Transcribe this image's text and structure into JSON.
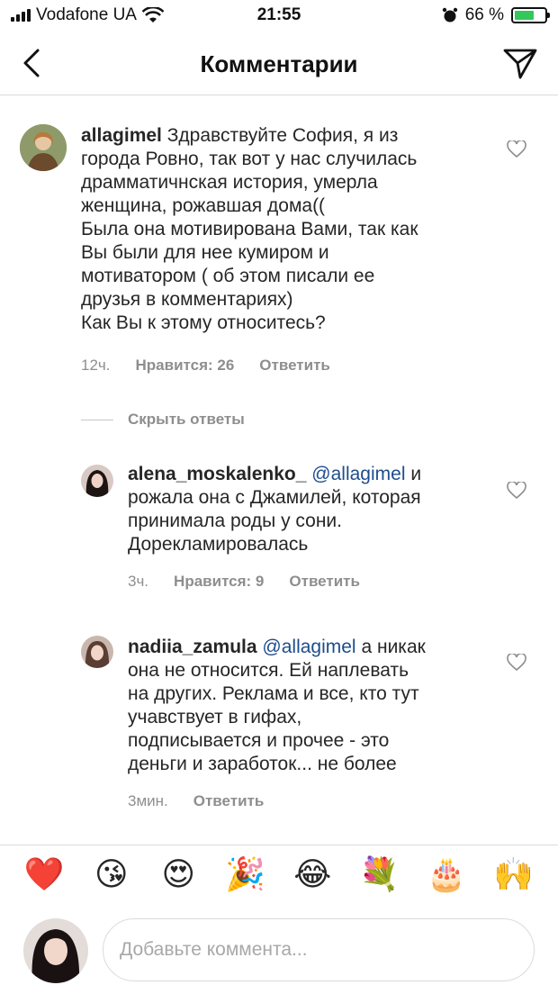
{
  "status_bar": {
    "carrier": "Vodafone UA",
    "time": "21:55",
    "battery": "66 %",
    "battery_level": 0.66
  },
  "header": {
    "title": "Комментарии",
    "back_icon": "chevron-left-icon",
    "send_icon": "paper-plane-icon"
  },
  "comments": [
    {
      "username": "allagimel",
      "mention": "",
      "lines": [
        "allagimel Здравствуйте София, я из",
        "города Ровно, так вот у нас случилась",
        "драмматичнская история, умерла",
        "женщина, рожавшая дома((",
        "Была она мотивирована Вами, так как",
        "Вы были для нее кумиром и",
        "мотиватором ( об этом писали ее",
        "друзья в комментариях)",
        "Как Вы к этому относитесь?"
      ],
      "first_line_rest": "Здравствуйте София, я из",
      "time": "12ч.",
      "likes": "Нравится: 26",
      "reply": "Ответить"
    },
    {
      "username": "alena_moskalenko_",
      "mention": "@allagimel",
      "first_line_rest": "и",
      "lines": [
        "рожала она с Джамилей, которая",
        "принимала роды у сони.",
        "Дорекламировалась"
      ],
      "time": "3ч.",
      "likes": "Нравится: 9",
      "reply": "Ответить"
    },
    {
      "username": "nadiia_zamula",
      "mention": "@allagimel",
      "first_line_rest": "а никак",
      "lines": [
        "она не относится. Ей наплевать",
        "на других. Реклама и все, кто тут",
        "учавствует в гифах,",
        "подписывается и прочее - это",
        "деньги и заработок... не более"
      ],
      "time": "3мин.",
      "reply": "Ответить"
    }
  ],
  "hide_replies": "Скрыть ответы",
  "emoji_bar": [
    "❤️",
    "😘",
    "😍",
    "🎉",
    "😂",
    "💐",
    "🎂",
    "🙌"
  ],
  "input": {
    "placeholder": "Добавьте коммента..."
  },
  "colors": {
    "mention": "#1e4d8c",
    "meta": "#8e8e8e",
    "battery": "#34c759"
  }
}
